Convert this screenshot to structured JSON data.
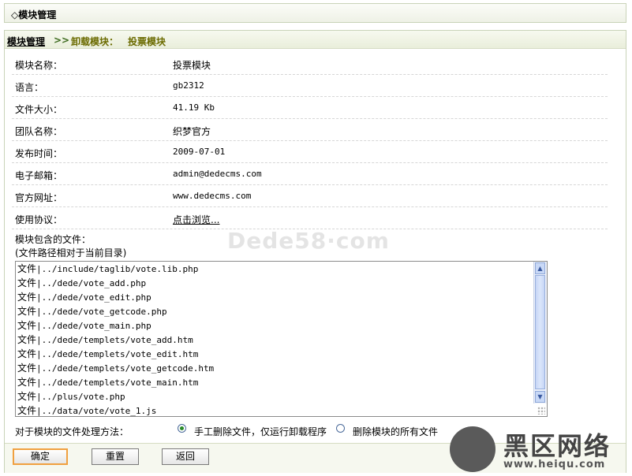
{
  "page": {
    "title": "◇模块管理"
  },
  "breadcrumb": {
    "root": "模块管理",
    "sep": ">>",
    "action": "卸载模块：",
    "module": "投票模块"
  },
  "info": [
    {
      "label": "模块名称：",
      "value": "投票模块"
    },
    {
      "label": "语言：",
      "value": "gb2312"
    },
    {
      "label": "文件大小：",
      "value": "41.19 Kb"
    },
    {
      "label": "团队名称：",
      "value": "织梦官方"
    },
    {
      "label": "发布时间：",
      "value": "2009-07-01"
    },
    {
      "label": "电子邮箱：",
      "value": "admin@dedecms.com"
    },
    {
      "label": "官方网址：",
      "value": "www.dedecms.com"
    },
    {
      "label": "使用协议：",
      "value": "点击浏览..."
    }
  ],
  "files": {
    "label": "模块包含的文件：",
    "hint": "(文件路径相对于当前目录)",
    "lines": [
      {
        "type": "文件",
        "path": "|../include/taglib/vote.lib.php"
      },
      {
        "type": "文件",
        "path": "|../dede/vote_add.php"
      },
      {
        "type": "文件",
        "path": "|../dede/vote_edit.php"
      },
      {
        "type": "文件",
        "path": "|../dede/vote_getcode.php"
      },
      {
        "type": "文件",
        "path": "|../dede/vote_main.php"
      },
      {
        "type": "文件",
        "path": "|../dede/templets/vote_add.htm"
      },
      {
        "type": "文件",
        "path": "|../dede/templets/vote_edit.htm"
      },
      {
        "type": "文件",
        "path": "|../dede/templets/vote_getcode.htm"
      },
      {
        "type": "文件",
        "path": "|../dede/templets/vote_main.htm"
      },
      {
        "type": "文件",
        "path": "|../plus/vote.php"
      },
      {
        "type": "文件",
        "path": "|../data/vote/vote_1.js"
      }
    ]
  },
  "method": {
    "label": "对于模块的文件处理方法：",
    "options": [
      {
        "label": "手工删除文件，仅运行卸载程序",
        "selected": true
      },
      {
        "label": "删除模块的所有文件",
        "selected": false
      }
    ]
  },
  "buttons": {
    "ok": "确定",
    "reset": "重置",
    "back": "返回"
  },
  "watermark": "Dede58·com",
  "logo": {
    "name": "黑区网络",
    "url": "www.heiqu.com"
  }
}
